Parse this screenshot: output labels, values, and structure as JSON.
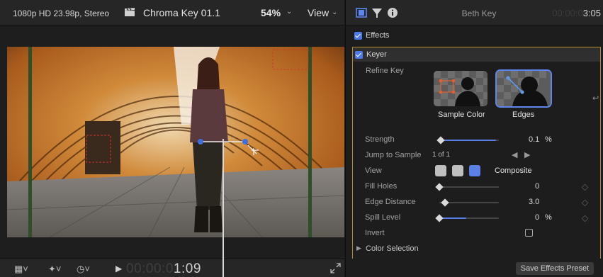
{
  "viewer": {
    "format": "1080p HD 23.98p, Stereo",
    "clip_title": "Chroma Key 01.1",
    "zoom": "54%",
    "view_menu": "View",
    "timecode_dim": "00:00:0",
    "timecode_live": "1:09"
  },
  "inspector": {
    "clip_name": "Beth Key",
    "timecode_dim": "00:00:0",
    "timecode_live": "3:05",
    "effects_label": "Effects",
    "keyer_label": "Keyer",
    "refine_key_label": "Refine Key",
    "sample_color_label": "Sample Color",
    "edges_label": "Edges",
    "params": {
      "strength": {
        "label": "Strength",
        "value": "0.1",
        "unit": "%",
        "level": 0.02
      },
      "jump_to_sample": {
        "label": "Jump to Sample",
        "value": "1 of 1"
      },
      "view": {
        "label": "View",
        "value": "Composite"
      },
      "fill_holes": {
        "label": "Fill Holes",
        "value": "0",
        "level": 0.0
      },
      "edge_distance": {
        "label": "Edge Distance",
        "value": "3.0",
        "level": 0.1
      },
      "spill_level": {
        "label": "Spill Level",
        "value": "0",
        "unit": "%",
        "level": 0.0
      },
      "invert": {
        "label": "Invert"
      }
    },
    "color_selection_label": "Color Selection",
    "save_button": "Save Effects Preset"
  },
  "colors": {
    "accent": "#5a7ee6",
    "keyer_border": "#b48a2b",
    "checkbox": "#4c7ae6"
  },
  "icons": [
    "clapper-icon",
    "chevron-down-icon",
    "film-icon",
    "filter-icon",
    "info-icon",
    "play-icon",
    "fullscreen-icon",
    "transform-icon",
    "effects-icon",
    "speed-icon",
    "reset-icon",
    "arrow-left-icon",
    "arrow-right-icon"
  ]
}
